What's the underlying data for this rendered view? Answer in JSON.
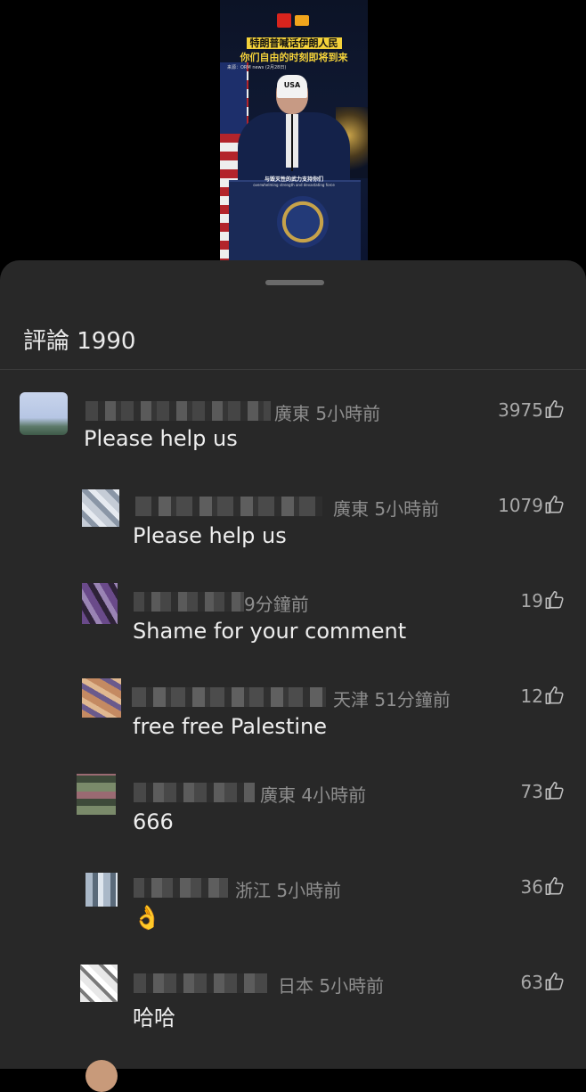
{
  "video": {
    "headline_line1": "特朗普喊话伊朗人民",
    "headline_line2": "你们自由的时刻即将到来",
    "source": "来源：ORM news (2月28日)",
    "cap_text": "USA",
    "subtitle_zh": "与毁灭性的武力支持你们",
    "subtitle_en": "overwhelming strength and devastating force"
  },
  "comments_sheet": {
    "title": "評論 1990",
    "comments": [
      {
        "location_time": "廣東 5小時前",
        "likes": "3975",
        "text": "Please help us"
      },
      {
        "location_time": "廣東 5小時前",
        "likes": "1079",
        "text": "Please help us"
      },
      {
        "location_time": "9分鐘前",
        "likes": "19",
        "text": "Shame for your comment"
      },
      {
        "location_time": "天津 51分鐘前",
        "likes": "12",
        "text": "free free Palestine"
      },
      {
        "location_time": "廣東 4小時前",
        "likes": "73",
        "text": "666"
      },
      {
        "location_time": "浙江 5小時前",
        "likes": "36",
        "text": "👌"
      },
      {
        "location_time": "日本 5小時前",
        "likes": "63",
        "text": "哈哈"
      }
    ]
  },
  "icons": {
    "like": "thumbs-up-icon",
    "ok": "ok-hand-icon"
  }
}
